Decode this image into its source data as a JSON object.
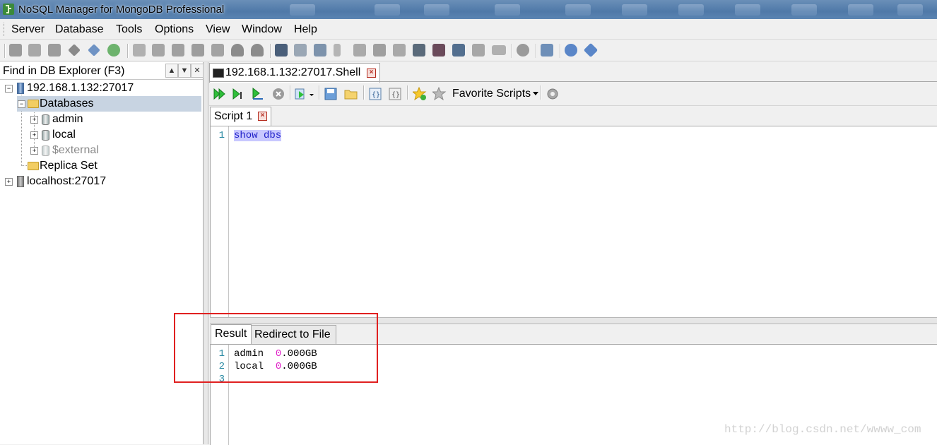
{
  "window": {
    "title": "NoSQL Manager for MongoDB Professional"
  },
  "menu": [
    "Server",
    "Database",
    "Tools",
    "Options",
    "View",
    "Window",
    "Help"
  ],
  "toolbar_icons": [
    "register-server-icon",
    "edit-server-icon",
    "server-properties-icon",
    "connect-icon",
    "disconnect-icon",
    "refresh-icon",
    "create-database-icon",
    "database-icon",
    "collection-icon",
    "document-icon",
    "function-icon",
    "user-icon",
    "users-icon",
    "shell-icon",
    "window-icon",
    "settings-icon",
    "tree-icon",
    "copy-icon",
    "export-icon",
    "import-icon",
    "monitor-icon",
    "stop-record-icon",
    "layout-icon",
    "clone-icon",
    "http-icon",
    "gear-icon",
    "home-icon",
    "help-icon",
    "info-icon"
  ],
  "explorer": {
    "find_label": "Find in DB Explorer (F3)",
    "tree": [
      {
        "label": "192.168.1.132:27017",
        "icon": "server-icon",
        "level": 0
      },
      {
        "label": "Databases",
        "icon": "folder-icon",
        "level": 1,
        "selected": true
      },
      {
        "label": "admin",
        "icon": "database-icon",
        "level": 2
      },
      {
        "label": "local",
        "icon": "database-icon",
        "level": 2
      },
      {
        "label": "$external",
        "icon": "database-icon",
        "level": 2,
        "dimmed": true
      },
      {
        "label": "Replica Set",
        "icon": "folder-icon",
        "level": 1
      },
      {
        "label": "localhost:27017",
        "icon": "server-icon",
        "level": 0
      }
    ]
  },
  "document_tab": {
    "label": "192.168.1.132:27017.Shell"
  },
  "shell_toolbar": {
    "favorite_scripts": "Favorite Scripts"
  },
  "script_tab": {
    "label": "Script 1"
  },
  "editor": {
    "lines": [
      {
        "num": "1",
        "text": "show dbs"
      }
    ]
  },
  "result_tabs": {
    "result": "Result",
    "redirect": "Redirect to File"
  },
  "result": {
    "lines": [
      {
        "num": "1",
        "name": "admin",
        "value": "0",
        "suffix": ".000GB"
      },
      {
        "num": "2",
        "name": "local",
        "value": "0",
        "suffix": ".000GB"
      },
      {
        "num": "3",
        "name": "",
        "value": "",
        "suffix": ""
      }
    ]
  },
  "watermark": "http://blog.csdn.net/wwww_com",
  "colors": {
    "title_bar": "#5b84b2",
    "selection": "#c8d4e2",
    "highlight": "#c8c8ff",
    "number": "#e020c8",
    "annotation": "#e02020"
  }
}
